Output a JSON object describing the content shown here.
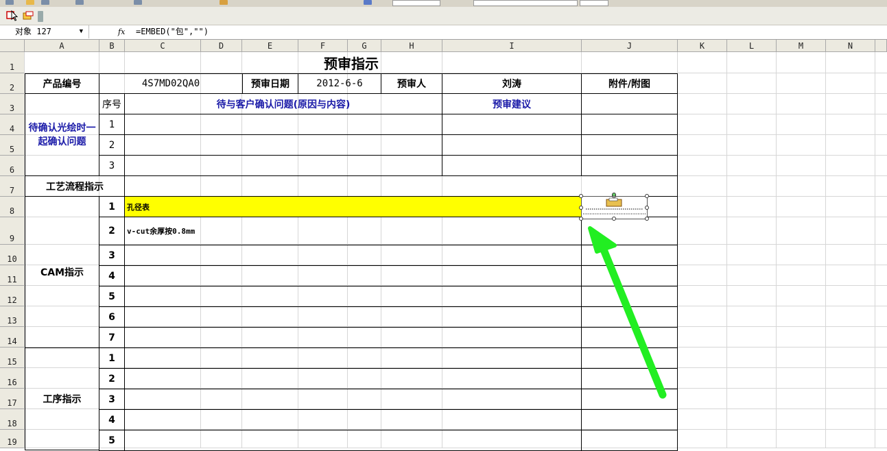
{
  "formula_bar": {
    "name_box": "对象 127",
    "fx_label": "fx",
    "formula": "=EMBED(\"包\",\"\")"
  },
  "columns": [
    "A",
    "B",
    "C",
    "D",
    "E",
    "F",
    "G",
    "H",
    "I",
    "J",
    "K",
    "L",
    "M",
    "N"
  ],
  "rows": [
    "1",
    "2",
    "3",
    "4",
    "5",
    "6",
    "7",
    "8",
    "9",
    "10",
    "11",
    "12",
    "13",
    "14",
    "15",
    "16",
    "17",
    "18",
    "19"
  ],
  "sheet": {
    "title": "预审指示",
    "product_no_label": "产品编号",
    "product_no": "4S7MD02QA0",
    "review_date_label": "预审日期",
    "review_date": "2012-6-6",
    "reviewer_label": "预审人",
    "reviewer": "刘涛",
    "attachment_label": "附件/附图",
    "seq_label": "序号",
    "issues_label": "待与客户确认问题(原因与内容)",
    "suggestion_label": "预审建议",
    "confirm_section": "待确认光绘时一起确认问题",
    "confirm_rows": [
      "1",
      "2",
      "3"
    ],
    "process_label": "工艺流程指示",
    "cam_section": "CAM指示",
    "cam_rows": [
      "1",
      "2",
      "3",
      "4",
      "5",
      "6",
      "7"
    ],
    "cam_item1": "孔径表",
    "cam_item2": "v-cut余厚按0.8mm",
    "proc_section": "工序指示",
    "proc_rows": [
      "1",
      "2",
      "3",
      "4",
      "5"
    ],
    "embedded_label": "包"
  },
  "colors": {
    "highlight": "#ffff00",
    "arrow": "#22ee22",
    "blue_text": "#1a1aa8"
  }
}
